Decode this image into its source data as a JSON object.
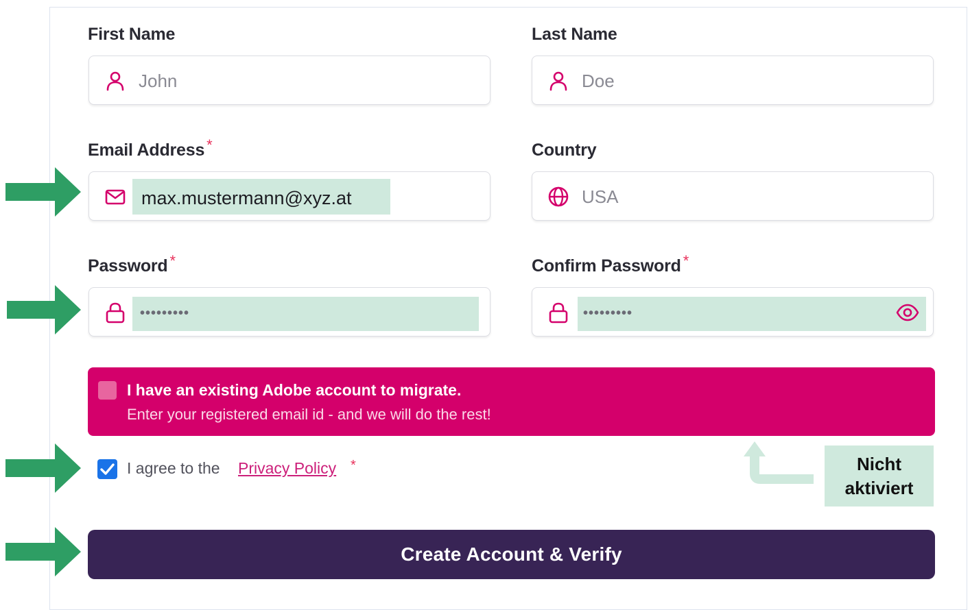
{
  "form": {
    "first_name": {
      "label": "First Name",
      "value": "John"
    },
    "last_name": {
      "label": "Last Name",
      "value": "Doe"
    },
    "email": {
      "label": "Email Address",
      "required_mark": "*",
      "value": "max.mustermann@xyz.at"
    },
    "country": {
      "label": "Country",
      "value": "USA"
    },
    "password": {
      "label": "Password",
      "required_mark": "*",
      "value": "•••••••••"
    },
    "confirm_password": {
      "label": "Confirm Password",
      "required_mark": "*",
      "value": "•••••••••"
    }
  },
  "migrate_banner": {
    "title": "I have an existing Adobe account to migrate.",
    "subtitle": "Enter your registered email id - and we will do the rest!",
    "checked": false
  },
  "privacy": {
    "text": "I agree to the",
    "link": "Privacy Policy",
    "required_mark": "*",
    "checked": true
  },
  "submit_label": "Create Account & Verify",
  "annotation": {
    "line1": "Nicht",
    "line2": "aktiviert"
  },
  "colors": {
    "icon": "#d4006b",
    "banner": "#d4006b",
    "button": "#382455",
    "highlight": "#cfe9dd",
    "arrow": "#2e9e64",
    "checkbox": "#1a73e8"
  },
  "icons": {
    "name": "user-icon",
    "email": "mail-icon",
    "country": "globe-icon",
    "password": "lock-icon",
    "toggle": "eye-icon"
  }
}
